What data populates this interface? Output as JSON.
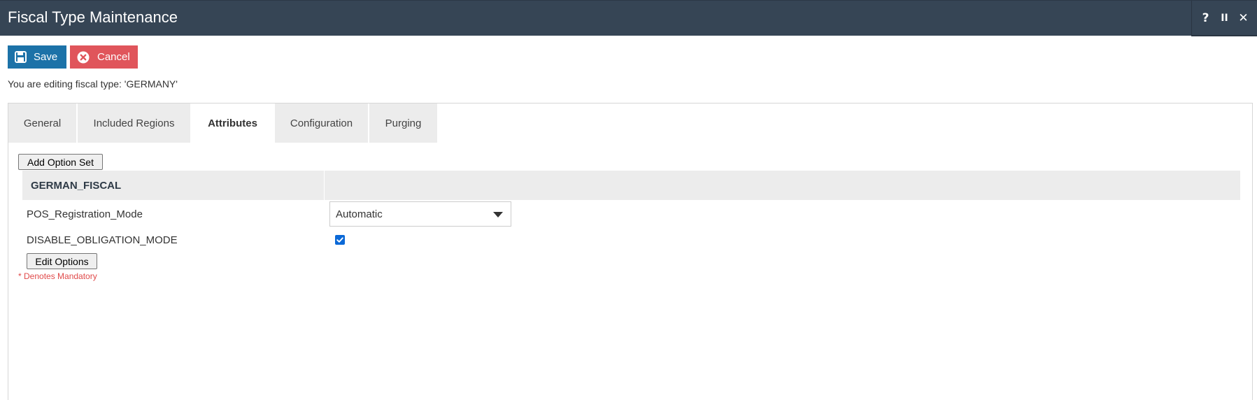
{
  "window": {
    "title": "Fiscal Type Maintenance",
    "controls": {
      "help": "?",
      "pause": "II",
      "close": "✕"
    }
  },
  "toolbar": {
    "save_label": "Save",
    "cancel_label": "Cancel"
  },
  "editing_message": "You are editing fiscal type: 'GERMANY'",
  "tabs": [
    {
      "label": "General",
      "active": false
    },
    {
      "label": "Included Regions",
      "active": false
    },
    {
      "label": "Attributes",
      "active": true
    },
    {
      "label": "Configuration",
      "active": false
    },
    {
      "label": "Purging",
      "active": false
    }
  ],
  "attributes": {
    "add_option_set_label": "Add Option Set",
    "option_set_name": "GERMAN_FISCAL",
    "rows": [
      {
        "label": "POS_Registration_Mode",
        "type": "select",
        "value": "Automatic"
      },
      {
        "label": "DISABLE_OBLIGATION_MODE",
        "type": "checkbox",
        "checked": true
      }
    ],
    "edit_options_label": "Edit Options",
    "mandatory_note": "* Denotes Mandatory"
  },
  "colors": {
    "titlebar": "#364555",
    "save": "#1c72a8",
    "cancel": "#e0555b",
    "mandatory": "#e04a4a",
    "checkbox": "#0b69d7"
  }
}
